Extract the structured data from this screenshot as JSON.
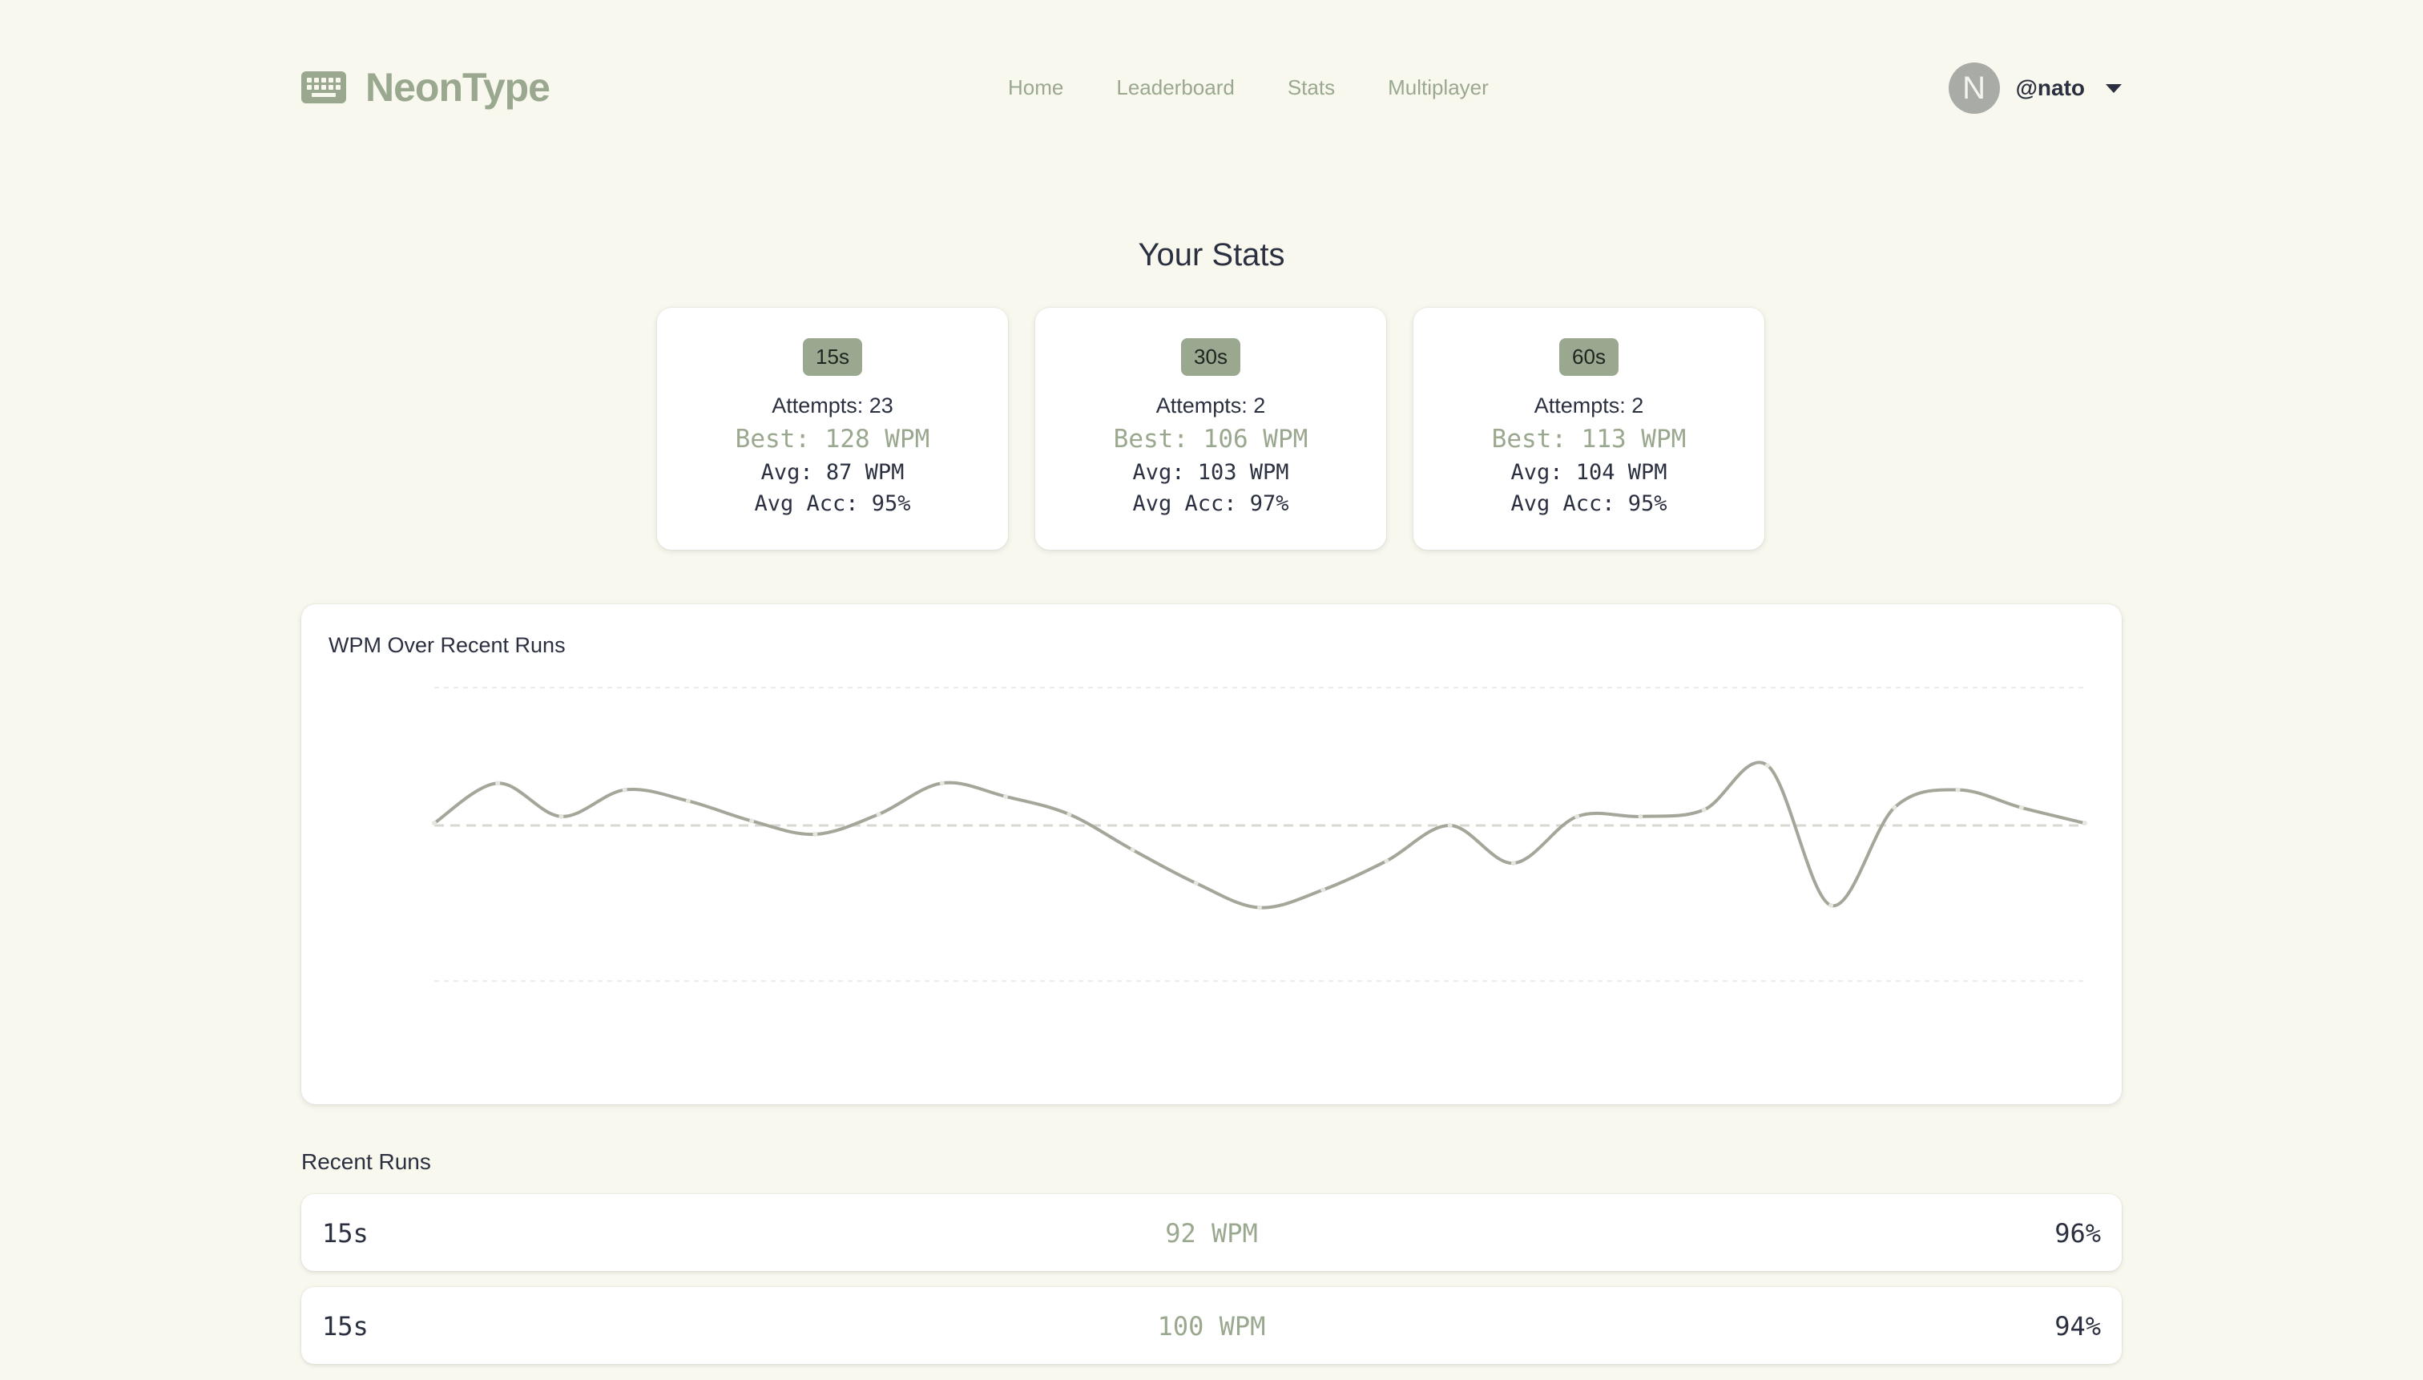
{
  "app": {
    "name": "NeonType",
    "icon": "keyboard-icon",
    "accent_color": "#9aa88f"
  },
  "nav": {
    "items": [
      {
        "label": "Home"
      },
      {
        "label": "Leaderboard"
      },
      {
        "label": "Stats"
      },
      {
        "label": "Multiplayer"
      }
    ]
  },
  "user": {
    "avatar_letter": "N",
    "handle": "@nato"
  },
  "stats": {
    "title": "Your Stats",
    "cards": [
      {
        "mode": "15s",
        "attempts": "Attempts: 23",
        "best": "Best: 128 WPM",
        "avg": "Avg: 87 WPM",
        "acc": "Avg Acc: 95%"
      },
      {
        "mode": "30s",
        "attempts": "Attempts: 2",
        "best": "Best: 106 WPM",
        "avg": "Avg: 103 WPM",
        "acc": "Avg Acc: 97%"
      },
      {
        "mode": "60s",
        "attempts": "Attempts: 2",
        "best": "Best: 113 WPM",
        "avg": "Avg: 104 WPM",
        "acc": "Avg Acc: 95%"
      }
    ]
  },
  "chart": {
    "title": "WPM Over Recent Runs"
  },
  "chart_data": {
    "type": "line",
    "title": "WPM Over Recent Runs",
    "xlabel": "",
    "ylabel": "",
    "grid": true,
    "ylim": [
      0,
      150
    ],
    "average_line": 88,
    "series": [
      {
        "values": [
          89,
          107,
          92,
          104,
          99,
          90,
          84,
          93,
          107,
          101,
          93,
          77,
          62,
          51,
          59,
          72,
          88,
          71,
          92,
          92,
          95,
          115,
          52,
          96,
          104,
          96,
          89
        ],
        "color": "#a3a799"
      }
    ]
  },
  "recent": {
    "title": "Recent Runs",
    "runs": [
      {
        "mode": "15s",
        "wpm": "92 WPM",
        "acc": "96%"
      },
      {
        "mode": "15s",
        "wpm": "100 WPM",
        "acc": "94%"
      }
    ]
  }
}
